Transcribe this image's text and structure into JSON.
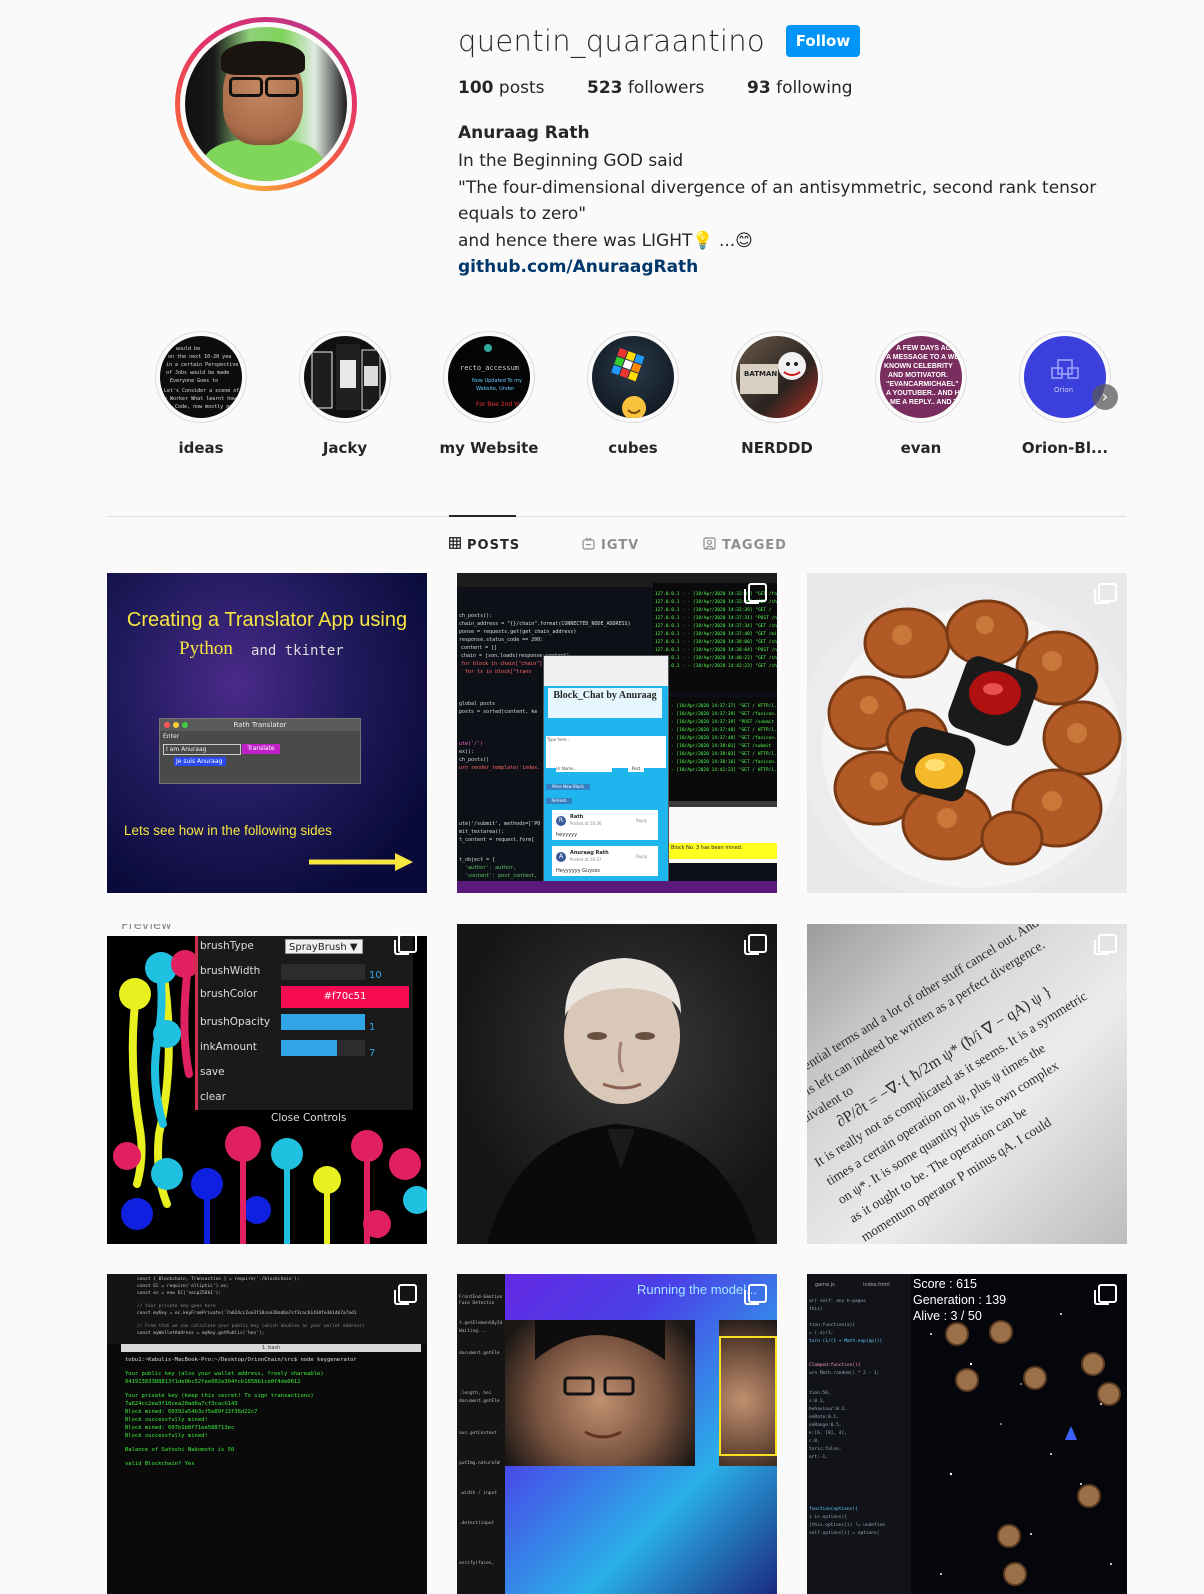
{
  "profile": {
    "username": "quentin_quaraantino",
    "follow_label": "Follow",
    "posts_count": "100",
    "posts_label": "posts",
    "followers_count": "523",
    "followers_label": "followers",
    "following_count": "93",
    "following_label": "following",
    "full_name": "Anuraag Rath",
    "bio_lines": [
      "In the Beginning GOD said",
      "\"The four-dimensional divergence of an antisymmetric, second rank tensor",
      "equals to zero\"",
      "and hence there was LIGHT💡 ...😊"
    ],
    "link": "github.com/AnuraagRath"
  },
  "highlights": [
    {
      "label": "ideas"
    },
    {
      "label": "Jacky"
    },
    {
      "label": "my Website"
    },
    {
      "label": "cubes"
    },
    {
      "label": "NERDDD"
    },
    {
      "label": "evan"
    },
    {
      "label": "Orion-Bl..."
    }
  ],
  "highlights_next_icon": "chevron-right-icon",
  "tabs": [
    {
      "label": "POSTS",
      "icon": "grid-icon",
      "active": true
    },
    {
      "label": "IGTV",
      "icon": "igtv-icon",
      "active": false
    },
    {
      "label": "TAGGED",
      "icon": "tagged-icon",
      "active": false
    }
  ],
  "posts": {
    "p1": {
      "title_line1": "Creating a Translator App using",
      "title_python": "Python",
      "title_and": "and tkinter",
      "window_title": "Rath Translator",
      "enter_label": "Enter",
      "input_value": "I am Anuraag",
      "translate_button": "Translate",
      "output_value": "Je suis Anuraag",
      "footer": "Lets see how in the following sides"
    },
    "p2": {
      "app_title": "Block_Chat by Anuraag",
      "type_here": "Type here...",
      "ur_name": "Ur Name...",
      "post_btn": "Post",
      "mine_btn": "Mine New Block",
      "refresh_btn": "Refresh",
      "msg1_author": "Rath",
      "msg1_time": "Posted at 16:36",
      "msg1_text": "heyyyyy",
      "msg2_author": "Anuraag Rath",
      "msg2_time": "Posted at 16:37",
      "msg2_text": "Heyyyyyy Guysss",
      "reply": "Reply",
      "mined_note": "Block No. 3 has been mined."
    },
    "p4": {
      "preview": "Preview",
      "rows": [
        {
          "label": "brushType",
          "value": "SprayBrush ▼"
        },
        {
          "label": "brushWidth",
          "value": "10"
        },
        {
          "label": "brushColor",
          "value": "#f70c51"
        },
        {
          "label": "brushOpacity",
          "value": "1"
        },
        {
          "label": "inkAmount",
          "value": "7"
        },
        {
          "label": "save",
          "value": ""
        },
        {
          "label": "clear",
          "value": ""
        }
      ],
      "close": "Close Controls"
    },
    "p6": {
      "lines": [
        "The potential terms and a lot of other stuff cancel out. And it turns",
        "what is left can indeed be written as a perfect divergence.",
        "equivalent to",
        "∂P/∂t = −∇·{ ħ/2m ψ* (ħ/i ∇ − qA) ψ }",
        "It is really not as complicated as it seems. It is a symmetric",
        "times a certain operation on ψ, plus ψ times the",
        "on ψ*. It is some quantity plus its own complex",
        "as it ought to be. The operation can be",
        "momentum operator P minus qA. I could"
      ]
    },
    "p7": {
      "terminal_title": "1. bash",
      "prompt": "tobu1:~Kabulis-MacBook-Pro:~/Desktop/OrionChain/src$ node keygenerator",
      "lines": [
        "Your public key (also your wallet address, freely shareable)",
        "04191383388813f1de0bc52fee002e304fcb1058b1ce0f4de0612",
        "Your private key (keep this secret! To sign transactions)",
        "7a624cc2ea3f10cea20ad6a7cf3cacb143",
        "Block mined: 00392a54b3cf5e89f13f36d22c7",
        "Block successfully mined!",
        "Block mined: 007b1b8f71ee588713ec",
        "Block successfully mined!",
        "Balance of Satoshi Nakomoto is 50",
        "valid Blockchain? Yes"
      ]
    },
    "p8": {
      "running": "Running the model..."
    },
    "p9": {
      "score": "Score : 615",
      "generation": "Generation : 139",
      "alive": "Alive : 3 / 50",
      "tab1": "game.js",
      "tab2": "index.html"
    }
  },
  "colors": {
    "follow": "#0095f6",
    "link": "#00376b",
    "text": "#262626",
    "muted": "#8e8e8e",
    "border": "#dbdbdb",
    "background": "#fafafa"
  }
}
